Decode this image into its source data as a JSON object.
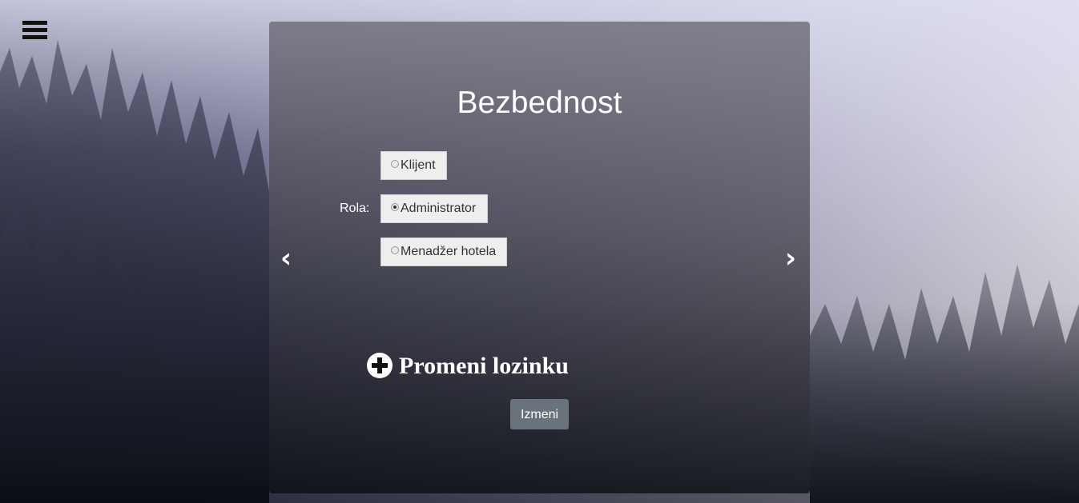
{
  "page": {
    "title": "Bezbednost",
    "icons": {
      "menu": "hamburger-icon",
      "prev": "chevron-left-icon",
      "next": "chevron-right-icon",
      "expand": "plus-circle-icon"
    }
  },
  "role": {
    "label": "Rola:",
    "options": [
      {
        "label": "Klijent",
        "checked": false
      },
      {
        "label": "Administrator",
        "checked": true
      },
      {
        "label": "Menadžer hotela",
        "checked": false
      }
    ]
  },
  "carousel": {
    "prev": "‹",
    "next": "›"
  },
  "password": {
    "toggle_label": "Promeni lozinku"
  },
  "actions": {
    "submit_label": "Izmeni"
  },
  "colors": {
    "panel": "#5a5a64",
    "button": "#6a737c",
    "text": "#ffffff"
  }
}
